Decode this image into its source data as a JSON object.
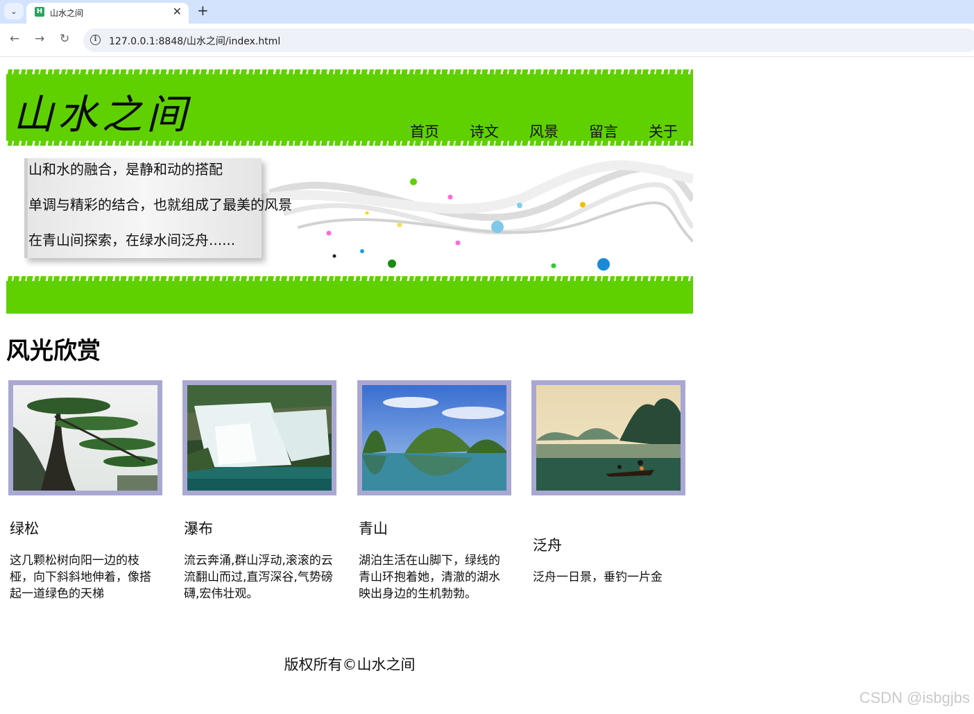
{
  "browser": {
    "tab_title": "山水之间",
    "favicon_letter": "H",
    "url": "127.0.0.1:8848/山水之间/index.html"
  },
  "header": {
    "site_title": "山水之间",
    "nav": [
      "首页",
      "诗文",
      "风景",
      "留言",
      "关于"
    ]
  },
  "banner": {
    "lines": [
      "山和水的融合，是静和动的搭配",
      "单调与精彩的结合，也就组成了最美的风景",
      "在青山间探索，在绿水间泛舟......"
    ]
  },
  "section_title": "风光欣赏",
  "gallery": [
    {
      "title": "绿松",
      "desc": "这几颗松树向阳一边的枝桠，向下斜斜地伸着，像搭起一道绿色的天梯"
    },
    {
      "title": "瀑布",
      "desc": "流云奔涌,群山浮动,滚滚的云流翻山而过,直泻深谷,气势磅礴,宏伟壮观。"
    },
    {
      "title": "青山",
      "desc": "湖泊生活在山脚下，绿线的青山环抱着她，清澈的湖水映出身边的生机勃勃。"
    },
    {
      "title": "泛舟",
      "desc": "泛舟一日景，垂钓一片金"
    }
  ],
  "footer": "版权所有©山水之间",
  "watermark": "CSDN @isbgjbs",
  "colors": {
    "accent_green": "#5fd100",
    "photo_frame": "#a9a8d2"
  }
}
